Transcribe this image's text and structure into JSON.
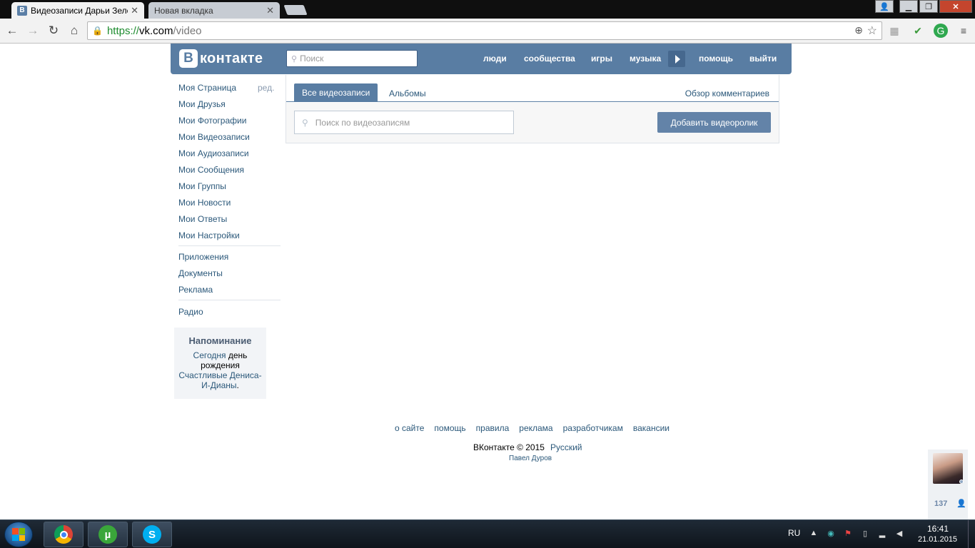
{
  "browser": {
    "tabs": [
      {
        "title": "Видеозаписи Дарьи Зелё",
        "favicon": "В"
      },
      {
        "title": "Новая вкладка"
      }
    ],
    "url_scheme": "https://",
    "url_host": "vk.com",
    "url_path": "/video"
  },
  "vk": {
    "logo_letter": "В",
    "logo_text": "контакте",
    "search_placeholder": "Поиск",
    "nav": [
      "люди",
      "сообщества",
      "игры",
      "музыка",
      "помощь",
      "выйти"
    ]
  },
  "menu": {
    "edit_label": "ред.",
    "items": [
      "Моя Страница",
      "Мои Друзья",
      "Мои Фотографии",
      "Мои Видеозаписи",
      "Мои Аудиозаписи",
      "Мои Сообщения",
      "Мои Группы",
      "Мои Новости",
      "Мои Ответы",
      "Мои Настройки"
    ],
    "extra": [
      "Приложения",
      "Документы",
      "Реклама"
    ],
    "radio": "Радио"
  },
  "reminder": {
    "title": "Напоминание",
    "today": "Сегодня",
    "text": " день рождения ",
    "person": "Счастливые Дениса-И-Дианы",
    "dot": "."
  },
  "video": {
    "tab_all": "Все видеозаписи",
    "tab_albums": "Альбомы",
    "comments_link": "Обзор комментариев",
    "search_placeholder": "Поиск по видеозаписям",
    "add_button": "Добавить видеоролик"
  },
  "footer": {
    "links": [
      "о сайте",
      "помощь",
      "правила",
      "реклама",
      "разработчикам",
      "вакансии"
    ],
    "copyright": "ВКонтакте © 2015",
    "language": "Русский",
    "author": "Павел Дуров"
  },
  "friends_online": {
    "count": "137"
  },
  "taskbar": {
    "lang": "RU",
    "time": "16:41",
    "date": "21.01.2015"
  }
}
